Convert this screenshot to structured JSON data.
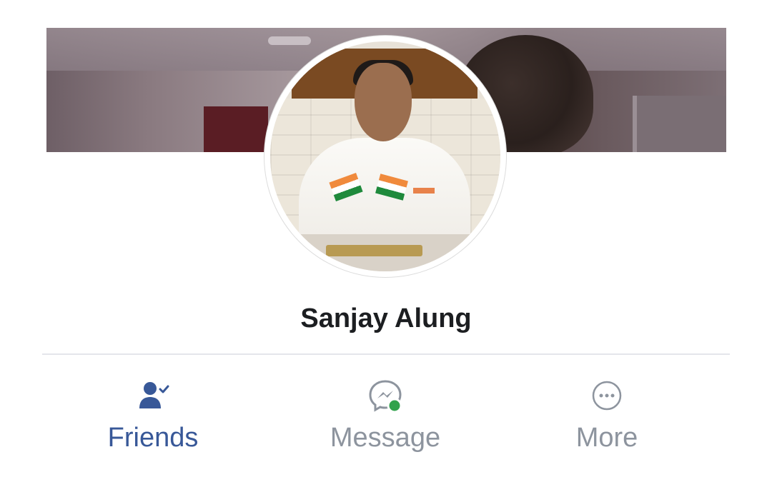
{
  "profile": {
    "name": "Sanjay Alung"
  },
  "actions": {
    "friends": {
      "label": "Friends",
      "icon": "friends-check-icon"
    },
    "message": {
      "label": "Message",
      "icon": "messenger-icon"
    },
    "more": {
      "label": "More",
      "icon": "more-dots-icon"
    }
  },
  "colors": {
    "friends_accent": "#385898",
    "inactive": "#8d949e",
    "online_dot": "#31a24c"
  }
}
